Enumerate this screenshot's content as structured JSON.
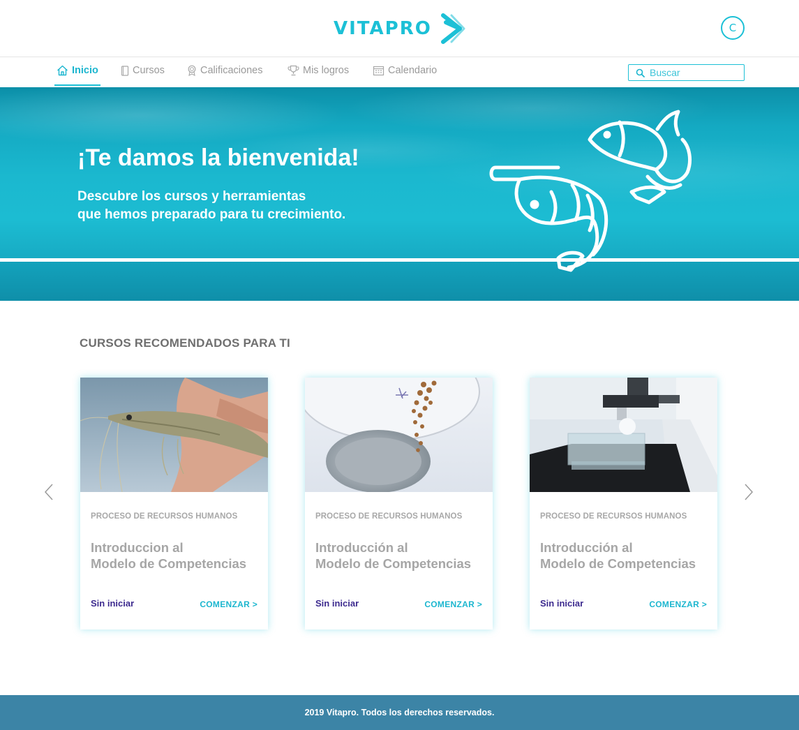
{
  "brand": {
    "name": "VITAPRO",
    "accent": "#1cc0d6",
    "footer_bg": "#3c84a6"
  },
  "user": {
    "initial": "C"
  },
  "nav": {
    "items": [
      {
        "label": "Inicio",
        "icon": "home-icon",
        "active": true
      },
      {
        "label": "Cursos",
        "icon": "book-icon",
        "active": false
      },
      {
        "label": "Calificaciones",
        "icon": "award-icon",
        "active": false
      },
      {
        "label": "Mis logros",
        "icon": "trophy-icon",
        "active": false
      },
      {
        "label": "Calendario",
        "icon": "calendar-icon",
        "active": false
      }
    ],
    "search_placeholder": "Buscar"
  },
  "hero": {
    "title": "¡Te damos la bienvenida!",
    "subtitle_line1": "Descubre los cursos y herramientas",
    "subtitle_line2": "que hemos preparado para tu crecimiento."
  },
  "recommended": {
    "title": "CURSOS RECOMENDADOS PARA TI",
    "courses": [
      {
        "category": "PROCESO DE RECURSOS HUMANOS",
        "title_line1": "Introduccion al",
        "title_line2": "Modelo de Competencias",
        "status": "Sin iniciar",
        "cta": "COMENZAR >",
        "image": "shrimp-in-hand"
      },
      {
        "category": "PROCESO DE RECURSOS HUMANOS",
        "title_line1": "Introducción al",
        "title_line2": "Modelo de Competencias",
        "status": "Sin iniciar",
        "cta": "COMENZAR >",
        "image": "feed-pellets-pouring"
      },
      {
        "category": "PROCESO DE RECURSOS HUMANOS",
        "title_line1": "Introducción al",
        "title_line2": "Modelo de Competencias",
        "status": "Sin iniciar",
        "cta": "COMENZAR >",
        "image": "microscope-lab"
      }
    ]
  },
  "footer": {
    "text": "2019 Vitapro. Todos los derechos reservados."
  }
}
